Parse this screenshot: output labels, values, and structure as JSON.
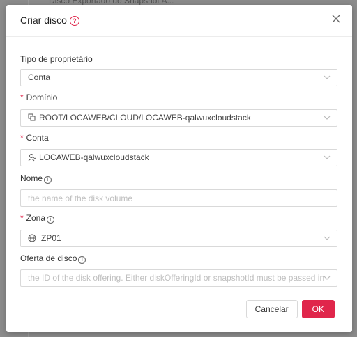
{
  "background": {
    "text": "Disco Exportado do Snapshot A..."
  },
  "dialog": {
    "title": "Criar disco",
    "help_icon": "question-circle-icon",
    "close_icon": "close-icon"
  },
  "form": {
    "owner_type": {
      "label": "Tipo de proprietário",
      "value": "Conta"
    },
    "domain": {
      "label": "Domínio",
      "required": true,
      "icon": "domain-tree-icon",
      "value": "ROOT/LOCAWEB/CLOUD/LOCAWEB-qalwuxcloudstack"
    },
    "account": {
      "label": "Conta",
      "required": true,
      "icon": "user-icon",
      "value": "LOCAWEB-qalwuxcloudstack"
    },
    "name": {
      "label": "Nome",
      "info_icon": "info-circle-icon",
      "placeholder": "the name of the disk volume",
      "value": ""
    },
    "zone": {
      "label": "Zona",
      "required": true,
      "info_icon": "info-circle-icon",
      "icon": "globe-icon",
      "value": "ZP01"
    },
    "disk_offering": {
      "label": "Oferta de disco",
      "info_icon": "info-circle-icon",
      "placeholder": "the ID of the disk offering. Either diskOfferingId or snapshotId must be passed in."
    }
  },
  "footer": {
    "cancel_label": "Cancelar",
    "ok_label": "OK"
  },
  "colors": {
    "accent": "#e0264b",
    "border": "#d9d9d9",
    "placeholder": "#bfbfbf"
  }
}
